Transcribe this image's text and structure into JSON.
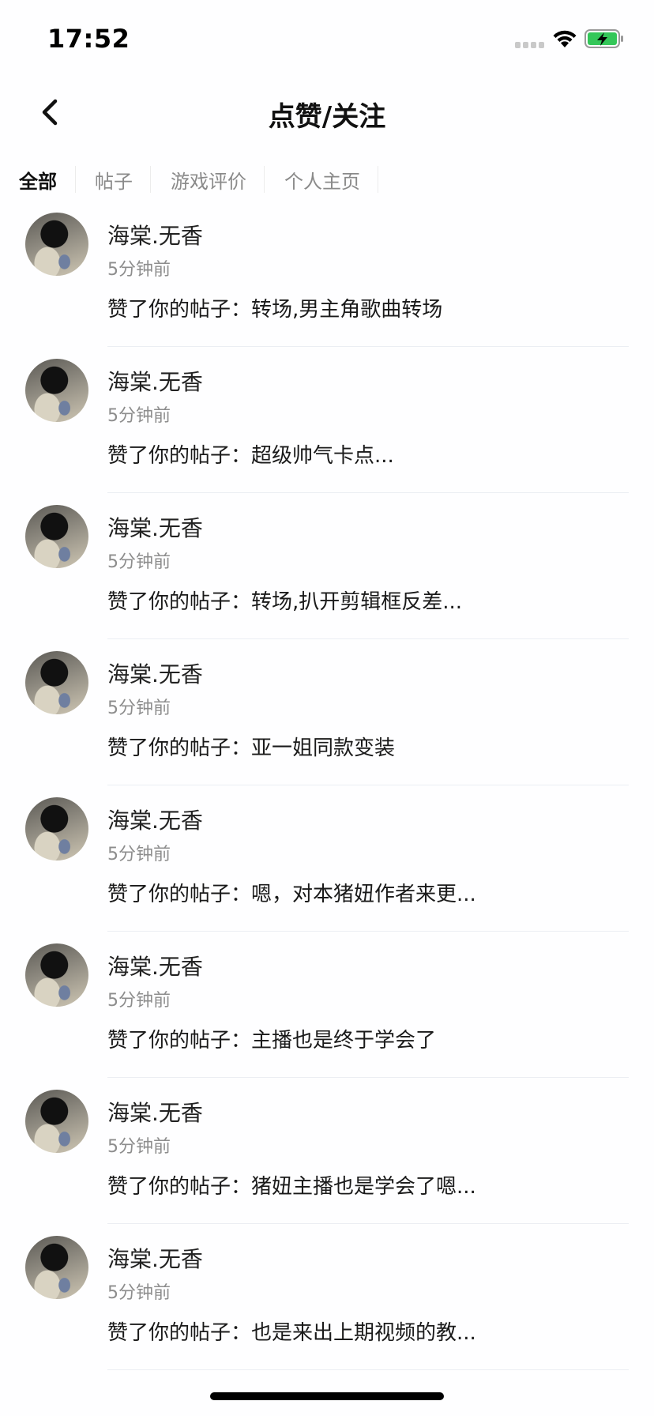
{
  "status_bar": {
    "time": "17:52",
    "battery_color": "#34c759"
  },
  "nav": {
    "title": "点赞/关注",
    "back_icon": "chevron-left-icon"
  },
  "tabs": [
    {
      "label": "全部",
      "active": true
    },
    {
      "label": "帖子",
      "active": false
    },
    {
      "label": "游戏评价",
      "active": false
    },
    {
      "label": "个人主页",
      "active": false
    }
  ],
  "notifications": [
    {
      "user": "海棠.无香",
      "time": "5分钟前",
      "text": "赞了你的帖子：转场,男主角歌曲转场"
    },
    {
      "user": "海棠.无香",
      "time": "5分钟前",
      "text": "赞了你的帖子：超级帅气卡点..."
    },
    {
      "user": "海棠.无香",
      "time": "5分钟前",
      "text": "赞了你的帖子：转场,扒开剪辑框反差..."
    },
    {
      "user": "海棠.无香",
      "time": "5分钟前",
      "text": "赞了你的帖子：亚一姐同款变装"
    },
    {
      "user": "海棠.无香",
      "time": "5分钟前",
      "text": "赞了你的帖子：嗯，对本猪妞作者来更..."
    },
    {
      "user": "海棠.无香",
      "time": "5分钟前",
      "text": "赞了你的帖子：主播也是终于学会了"
    },
    {
      "user": "海棠.无香",
      "time": "5分钟前",
      "text": "赞了你的帖子：猪妞主播也是学会了嗯..."
    },
    {
      "user": "海棠.无香",
      "time": "5分钟前",
      "text": "赞了你的帖子：也是来出上期视频的教..."
    }
  ]
}
